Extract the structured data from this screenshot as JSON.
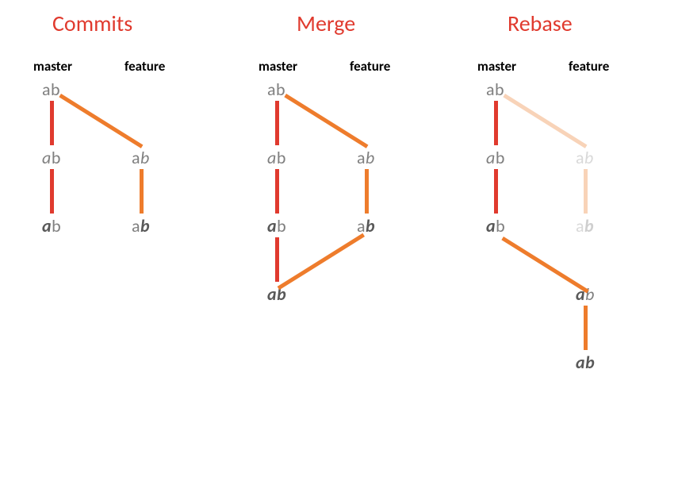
{
  "titles": {
    "commits": "Commits",
    "merge": "Merge",
    "rebase": "Rebase"
  },
  "branches": {
    "master": "master",
    "feature": "feature"
  },
  "letters": {
    "a": "a",
    "b": "b"
  }
}
